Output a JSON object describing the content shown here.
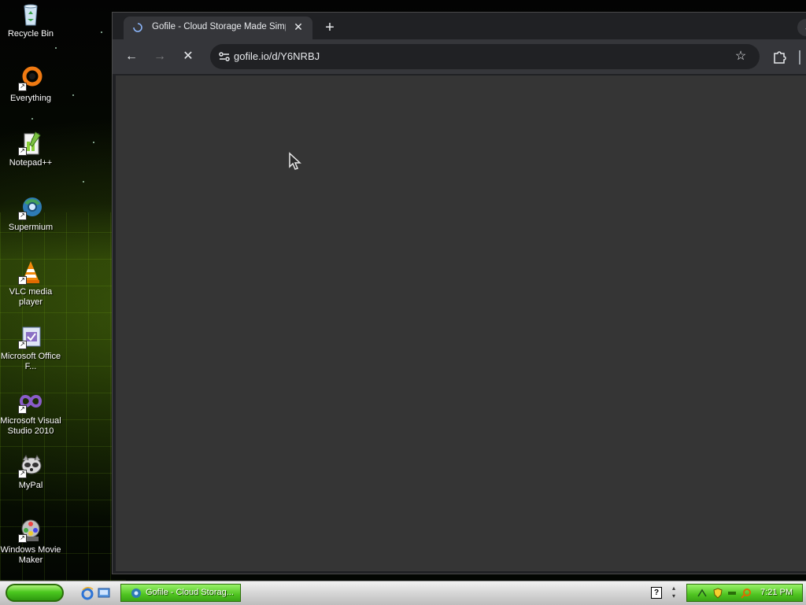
{
  "desktop": {
    "icons": [
      {
        "label": "Recycle Bin",
        "icon": "recycle-bin-icon"
      },
      {
        "label": "Everything",
        "icon": "everything-search-icon"
      },
      {
        "label": "Notepad++",
        "icon": "notepad-plus-plus-icon"
      },
      {
        "label": "Supermium",
        "icon": "supermium-browser-icon"
      },
      {
        "label": "VLC media player",
        "icon": "vlc-cone-icon"
      },
      {
        "label": "Microsoft Office F...",
        "icon": "office-file-validation-icon"
      },
      {
        "label": "Microsoft Visual Studio 2010",
        "icon": "visual-studio-icon"
      },
      {
        "label": "MyPal",
        "icon": "mypal-raccoon-icon"
      },
      {
        "label": "Windows Movie Maker",
        "icon": "movie-maker-icon"
      }
    ]
  },
  "browser": {
    "tab": {
      "title": "Gofile - Cloud Storage Made Simple",
      "close_label": "✕"
    },
    "new_tab_label": "+",
    "tab_menu_label": "⌄",
    "toolbar": {
      "back_label": "←",
      "forward_label": "→",
      "stop_label": "✕",
      "url": "gofile.io/d/Y6NRBJ",
      "bookmark_label": "☆"
    },
    "page_background": "#353535"
  },
  "taskbar": {
    "task_item_label": "Gofile - Cloud Storag...",
    "help_label": "?",
    "clock": "7:21 PM",
    "accent": "#4fc421"
  }
}
